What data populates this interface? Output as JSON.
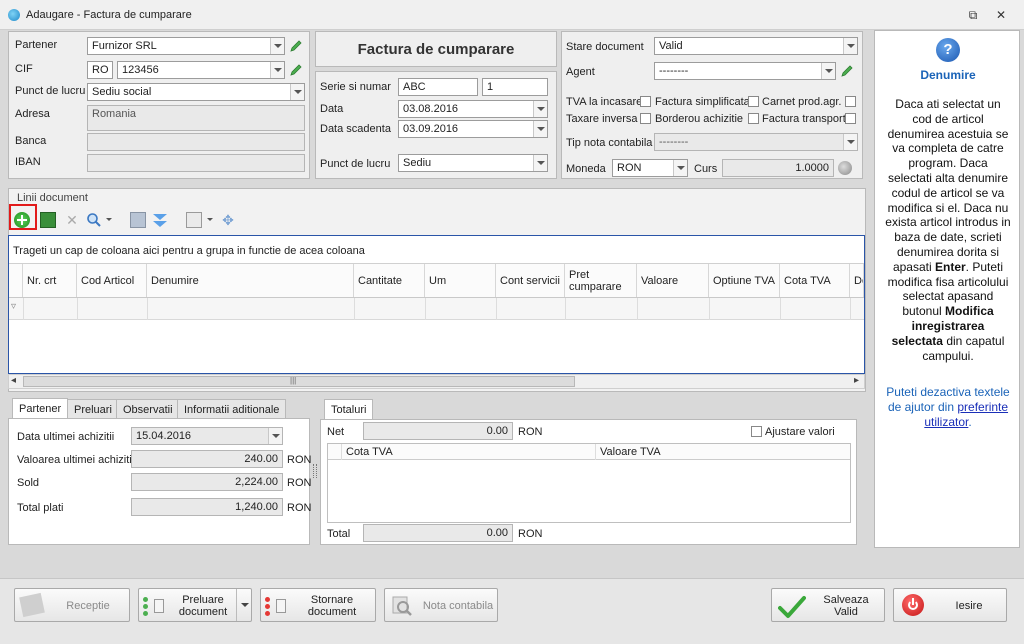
{
  "window": {
    "title": "Adaugare - Factura de cumparare",
    "restore_glyph": "⧉",
    "close_glyph": "✕"
  },
  "partner": {
    "partener_label": "Partener",
    "partener_value": "Furnizor SRL",
    "cif_label": "CIF",
    "cif_prefix": "RO",
    "cif_value": "123456",
    "punct_label": "Punct de lucru",
    "punct_value": "Sediu social",
    "adresa_label": "Adresa",
    "adresa_value": "Romania",
    "banca_label": "Banca",
    "iban_label": "IBAN"
  },
  "document": {
    "heading": "Factura de cumparare",
    "serie_label": "Serie si numar",
    "serie_value": "ABC",
    "numar_value": "1",
    "data_label": "Data",
    "data_value": "03.08.2016",
    "scadenta_label": "Data scadenta",
    "scadenta_value": "03.09.2016",
    "punct_label": "Punct de lucru",
    "punct_value": "Sediu"
  },
  "status": {
    "stare_label": "Stare document",
    "stare_value": "Valid",
    "agent_label": "Agent",
    "agent_value": "--------",
    "tva_incasare": "TVA la incasare",
    "factura_simplificata": "Factura simplificata",
    "carnet": "Carnet prod.agr.",
    "taxare_inversa": "Taxare inversa",
    "borderou": "Borderou achizitie",
    "factura_transport": "Factura transport",
    "tip_nota_label": "Tip nota contabila",
    "tip_nota_value": "--------",
    "moneda_label": "Moneda",
    "moneda_value": "RON",
    "curs_label": "Curs",
    "curs_value": "1.0000"
  },
  "lines": {
    "group_label": "Linii document",
    "group_hint": "Trageti un cap de coloana aici pentru a grupa in functie de acea coloana",
    "columns": [
      "Nr. crt",
      "Cod Articol",
      "Denumire",
      "Cantitate",
      "Um",
      "Cont servicii",
      "Pret cumparare",
      "Valoare",
      "Optiune TVA",
      "Cota TVA",
      "De"
    ],
    "filter_glyph": "▿",
    "scroll_left": "◂",
    "scroll_right": "▸",
    "scroll_grip": "|||"
  },
  "tabs": [
    "Partener",
    "Preluari",
    "Observatii",
    "Informatii aditionale"
  ],
  "partner_tab": {
    "data_ultimei_label": "Data ultimei achizitii",
    "data_ultimei_value": "15.04.2016",
    "valoarea_label": "Valoarea ultimei achizitii",
    "valoarea_value": "240.00",
    "valoarea_cur": "RON",
    "sold_label": "Sold",
    "sold_value": "2,224.00",
    "sold_cur": "RON",
    "total_plati_label": "Total plati",
    "total_plati_value": "1,240.00",
    "total_plati_cur": "RON"
  },
  "totals": {
    "tab": "Totaluri",
    "net_label": "Net",
    "net_value": "0.00",
    "net_cur": "RON",
    "ajustare_label": "Ajustare valori",
    "col_cota": "Cota TVA",
    "col_valoare": "Valoare TVA",
    "total_label": "Total",
    "total_value": "0.00",
    "total_cur": "RON"
  },
  "help": {
    "icon": "?",
    "title": "Denumire",
    "text_1": "Daca ati selectat un cod de articol denumirea acestuia se va completa de catre program. Daca selectati alta denumire codul de articol se va modifica si el. Daca nu exista articol introdus in baza de date, scrieti denumirea dorita si apasati ",
    "text_enter": "Enter",
    "text_2": ". Puteti modifica fisa articolului selectat apasand butonul ",
    "text_bold": "Modifica inregistrarea selectata",
    "text_3": " din capatul campului.",
    "link_1": "Puteti dezactiva textele de ajutor din ",
    "link_u": "preferinte utilizator",
    "link_2": "."
  },
  "buttons": {
    "receptie": "Receptie",
    "preluare_1": "Preluare",
    "preluare_2": "document",
    "stornare_1": "Stornare",
    "stornare_2": "document",
    "nota": "Nota contabila",
    "salveaza_1": "Salveaza",
    "salveaza_2": "Valid",
    "iesire": "Iesire"
  },
  "colors": {
    "accent": "#1a63b8",
    "add_green": "#2aa52a",
    "highlight_red": "#e21a1a",
    "exit_red": "#d42020"
  }
}
